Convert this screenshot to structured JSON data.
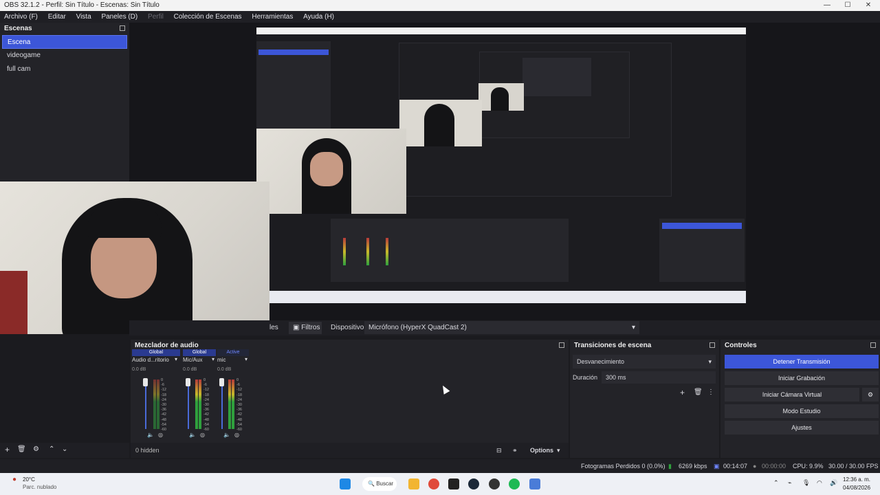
{
  "window": {
    "title": "OBS 32.1.2 - Perfil: Sin Título - Escenas: Sin Título"
  },
  "menu": [
    "Archivo (F)",
    "Editar",
    "Vista",
    "Paneles (D)",
    "Perfil",
    "Colección de Escenas",
    "Herramientas",
    "Ayuda (H)"
  ],
  "scenes": {
    "title": "Escenas",
    "items": [
      "Escena",
      "videogame",
      "full cam"
    ],
    "selected": "Escena"
  },
  "context": {
    "partial_label": "les",
    "filters_label": "Filtros",
    "device_label": "Dispositivo",
    "device_value": "Micrófono (HyperX QuadCast 2)"
  },
  "mixer": {
    "title": "Mezclador de audio",
    "channels": [
      {
        "badge": "Global",
        "name": "Audio d...ritorio",
        "db": "0.0 dB"
      },
      {
        "badge": "Global",
        "name": "Mic/Aux",
        "db": "0.0 dB"
      },
      {
        "badge": "Active",
        "name": "mic",
        "db": "0.0 dB"
      }
    ],
    "ticks": [
      "0",
      "-6",
      "-12",
      "-18",
      "-24",
      "-30",
      "-36",
      "-42",
      "-48",
      "-54",
      "-60"
    ],
    "hidden_label": "0 hidden",
    "options_label": "Options"
  },
  "transitions": {
    "title": "Transiciones de escena",
    "selected": "Desvanecimiento",
    "duration_label": "Duración",
    "duration_value": "300 ms"
  },
  "controls": {
    "title": "Controles",
    "buttons": [
      "Detener Transmisión",
      "Iniciar Grabación",
      "Iniciar Cámara Virtual",
      "Modo Estudio",
      "Ajustes"
    ]
  },
  "status": {
    "dropped": "Fotogramas Perdidos 0 (0.0%)",
    "bitrate": "6269 kbps",
    "stream_time": "00:14:07",
    "rec_time": "00:00:00",
    "cpu": "CPU: 9.9%",
    "fps": "30.00 / 30.00 FPS"
  },
  "taskbar": {
    "weather_temp": "20°C",
    "weather_desc": "Parc. nublado",
    "search": "Buscar",
    "time": "12:36 a. m.",
    "date": "04/08/2026"
  },
  "colors": {
    "accent": "#3c56d8",
    "panel": "#232328",
    "bg": "#1b1b1f"
  }
}
